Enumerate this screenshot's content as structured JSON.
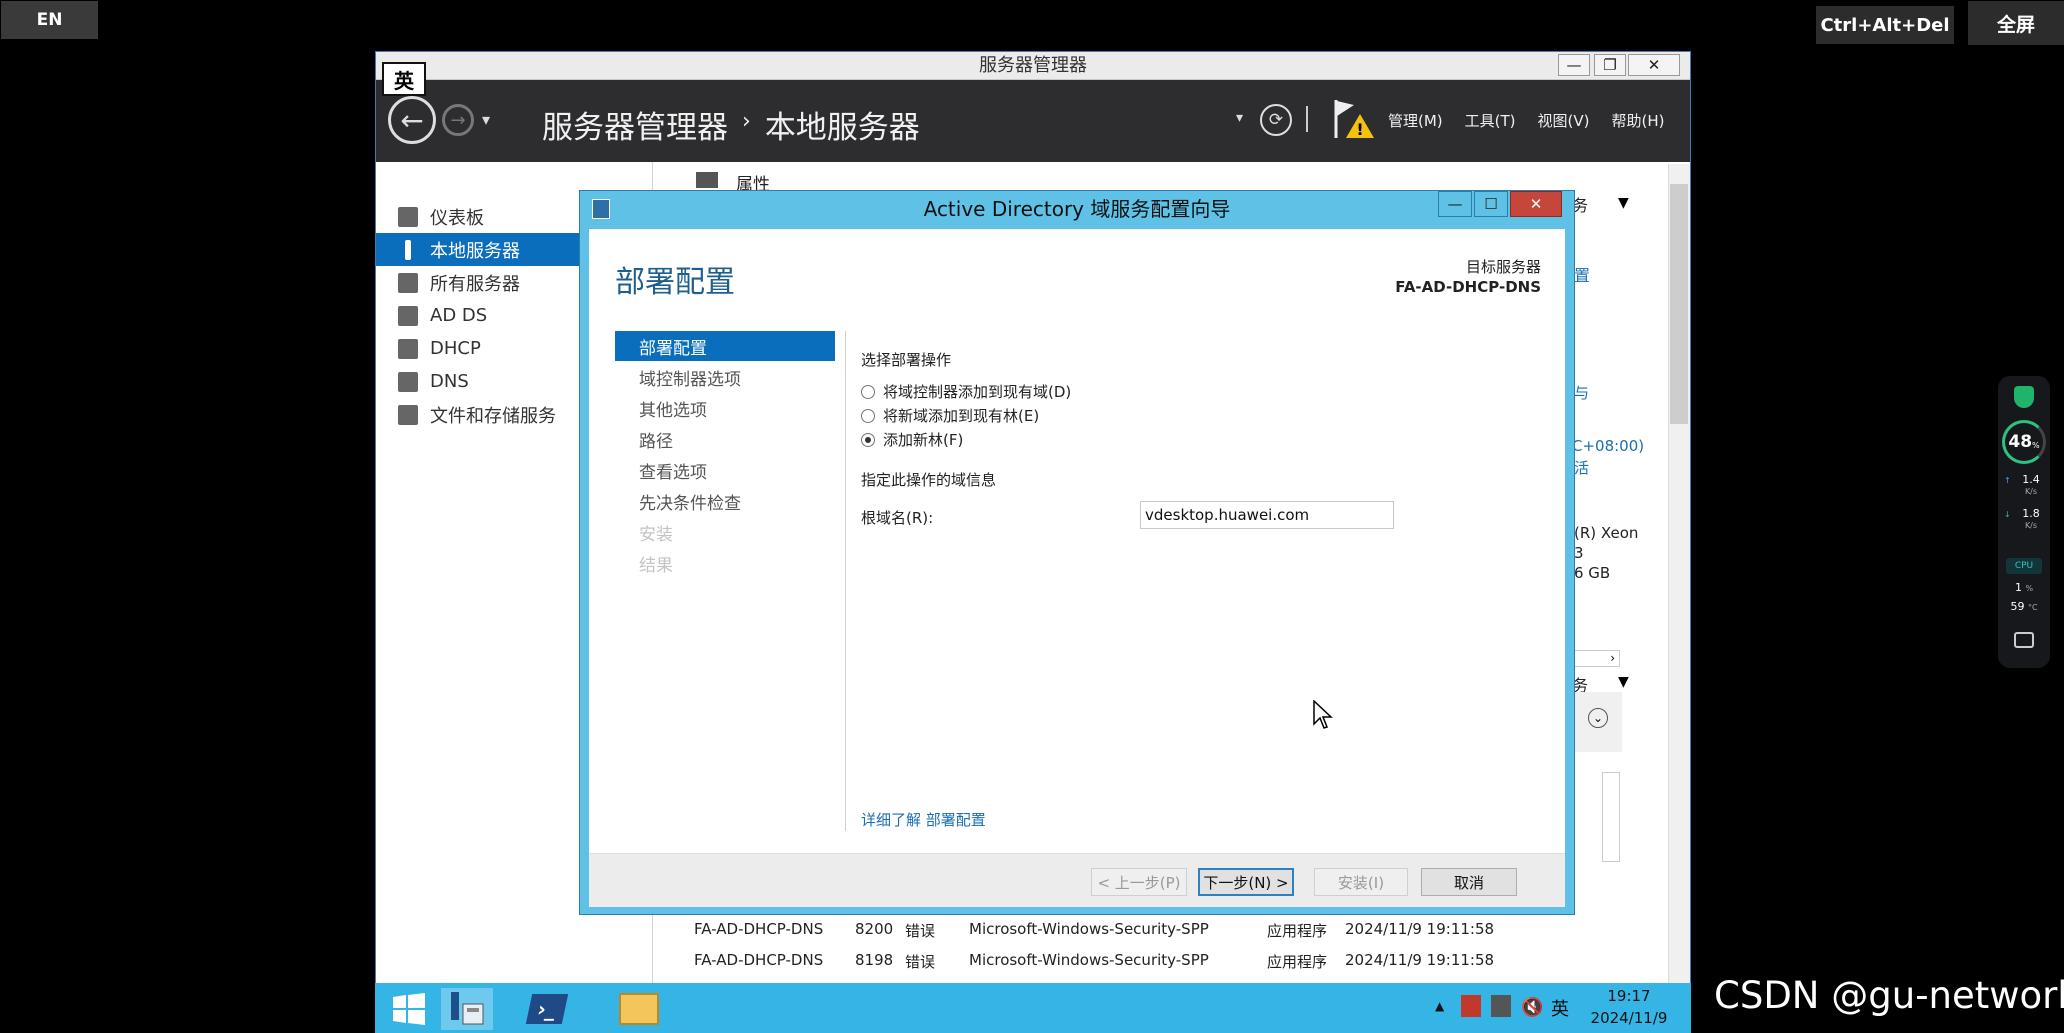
{
  "top": {
    "en": "EN",
    "ctrl_alt_del": "Ctrl+Alt+Del",
    "fullscreen": "全屏"
  },
  "ime_badge": "英",
  "server_manager": {
    "window_title": "服务器管理器",
    "breadcrumb_root": "服务器管理器",
    "breadcrumb_sep": "›",
    "breadcrumb_page": "本地服务器",
    "menus": [
      "管理(M)",
      "工具(T)",
      "视图(V)",
      "帮助(H)"
    ],
    "sidebar": [
      {
        "label": "仪表板"
      },
      {
        "label": "本地服务器"
      },
      {
        "label": "所有服务器"
      },
      {
        "label": "AD DS"
      },
      {
        "label": "DHCP"
      },
      {
        "label": "DNS"
      },
      {
        "label": "文件和存储服务"
      }
    ],
    "properties_label": "属性",
    "bg": {
      "tasks1": "务",
      "link1": "置",
      "text_yu": "与",
      "tz": "C+08:00)",
      "huo": "活",
      "xeon": "(R) Xeon",
      "three": "3",
      "mem": "6 GB",
      "tasks2": "务"
    },
    "events": [
      {
        "server": "FA-AD-DHCP-DNS",
        "id": "8200",
        "level": "错误",
        "source": "Microsoft-Windows-Security-SPP",
        "log": "应用程序",
        "time": "2024/11/9 19:11:58"
      },
      {
        "server": "FA-AD-DHCP-DNS",
        "id": "8198",
        "level": "错误",
        "source": "Microsoft-Windows-Security-SPP",
        "log": "应用程序",
        "time": "2024/11/9 19:11:58"
      }
    ]
  },
  "dialog": {
    "title": "Active Directory 域服务配置向导",
    "heading": "部署配置",
    "target_label": "目标服务器",
    "target_server": "FA-AD-DHCP-DNS",
    "steps": [
      {
        "label": "部署配置",
        "state": "active"
      },
      {
        "label": "域控制器选项",
        "state": "normal"
      },
      {
        "label": "其他选项",
        "state": "normal"
      },
      {
        "label": "路径",
        "state": "normal"
      },
      {
        "label": "查看选项",
        "state": "normal"
      },
      {
        "label": "先决条件检查",
        "state": "normal"
      },
      {
        "label": "安装",
        "state": "disabled"
      },
      {
        "label": "结果",
        "state": "disabled"
      }
    ],
    "select_op_label": "选择部署操作",
    "options": [
      {
        "label": "将域控制器添加到现有域(D)",
        "selected": false
      },
      {
        "label": "将新域添加到现有林(E)",
        "selected": false
      },
      {
        "label": "添加新林(F)",
        "selected": true
      }
    ],
    "domain_info_label": "指定此操作的域信息",
    "root_domain_label": "根域名(R):",
    "root_domain_value": "vdesktop.huawei.com",
    "more_link": "详细了解 部署配置",
    "buttons": {
      "prev": "< 上一步(P)",
      "next": "下一步(N) >",
      "install": "安装(I)",
      "cancel": "取消"
    }
  },
  "taskbar": {
    "ime": "英",
    "time": "19:17",
    "date": "2024/11/9"
  },
  "widget": {
    "percent": "48",
    "percent_unit": "%",
    "up": "1.4",
    "up_unit": "K/s",
    "down": "1.8",
    "down_unit": "K/s",
    "cpu_label": "CPU",
    "cpu": "1",
    "cpu_unit": "%",
    "temp": "59",
    "temp_unit": "°C"
  },
  "watermark": "CSDN @gu-network",
  "colors": {
    "accent": "#0a6ebd",
    "dialog_frame": "#5fc1e6",
    "taskbar": "#35b5e5",
    "header": "#2d2d30"
  }
}
